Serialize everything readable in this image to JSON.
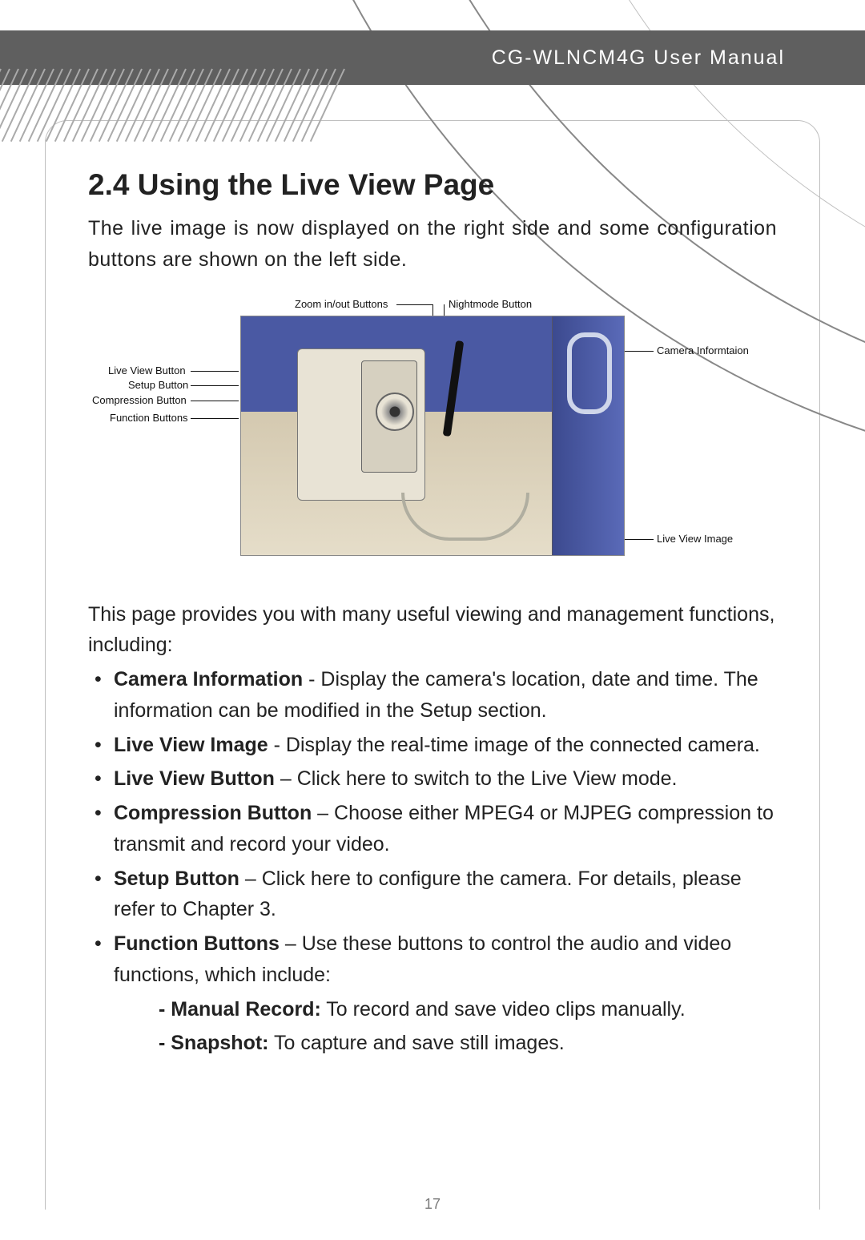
{
  "header": {
    "doc_title": "CG-WLNCM4G User Manual"
  },
  "section": {
    "heading": "2.4 Using the Live View Page",
    "intro": "The live image is now displayed on the right side and some configuration buttons are shown on the left side."
  },
  "diagram": {
    "labels": {
      "zoom": "Zoom in/out Buttons",
      "nightmode": "Nightmode Button",
      "camera_info": "Camera Informtaion",
      "live_view_btn": "Live View Button",
      "setup_btn": "Setup Button",
      "compression_btn": "Compression Button",
      "function_btns": "Function Buttons",
      "live_view_img": "Live View Image"
    }
  },
  "body": {
    "lead": "This page provides you with many useful viewing and management functions, including:",
    "items": [
      {
        "term": "Camera Information",
        "sep": " - ",
        "desc": "Display the camera's location, date and time. The information can be modified in the Setup section."
      },
      {
        "term": "Live View Image",
        "sep": " - ",
        "desc": "Display the real-time image of the connected camera."
      },
      {
        "term": "Live View Button",
        "sep": " – ",
        "desc": "Click here to switch to the Live View mode."
      },
      {
        "term": "Compression Button",
        "sep": " – ",
        "desc": "Choose either MPEG4 or MJPEG compression to transmit and record your video."
      },
      {
        "term": "Setup Button",
        "sep": " – ",
        "desc": "Click here to configure the camera. For details, please refer to Chapter 3."
      },
      {
        "term": "Function Buttons",
        "sep": " – ",
        "desc": "Use these buttons to control the audio and video functions, which include:"
      }
    ],
    "subitems": [
      {
        "term": "Manual Record:",
        "desc": " To record and save video clips manually."
      },
      {
        "term": "Snapshot:",
        "desc": " To capture and save still images."
      }
    ]
  },
  "page_number": "17"
}
